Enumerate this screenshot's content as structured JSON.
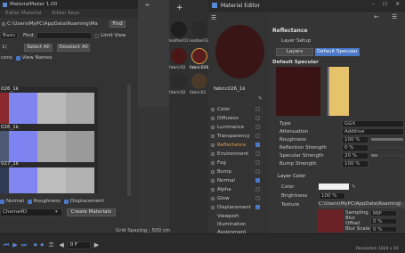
{
  "plugin": {
    "title": "MaterialMaker 1.00",
    "tabs": [
      "Editor Material",
      "Editor Keys"
    ],
    "path_value": "C:\\Users\\MyPC\\AppData\\Roaming\\Ma",
    "find_label": "Find",
    "preset_value": "Basic",
    "find_field_label": "Find:",
    "limit_view_label": "Limit View",
    "count_label": "1)",
    "select_all_label": "Select All",
    "deselect_all_label": "Deselect All",
    "icons_label": "cons",
    "view_names_label": "View Names",
    "rows": [
      {
        "label": "026_1k"
      },
      {
        "label": "026_1k"
      },
      {
        "label": "027_1k"
      }
    ],
    "bottom_checks": [
      "Normal",
      "Roughness",
      "Displacement"
    ],
    "renderer_value": "Chema4D",
    "create_materials_label": "Create Materials"
  },
  "timeline": {
    "grid_spacing": "Grid Spacing : 500 cm",
    "frame_value": "0 F"
  },
  "materials": {
    "items": [
      {
        "label": "leather01"
      },
      {
        "label": "leather03"
      },
      {
        "label": "fabric02"
      },
      {
        "label": "fabric026"
      },
      {
        "label": "fabric02"
      },
      {
        "label": "fabric01"
      }
    ]
  },
  "editor": {
    "title": "Material Editor",
    "preview_label": "fabric026_1k",
    "channels": [
      {
        "label": "Color",
        "on": false
      },
      {
        "label": "Diffusion",
        "on": false
      },
      {
        "label": "Luminance",
        "on": false
      },
      {
        "label": "Transparency",
        "on": false
      },
      {
        "label": "Reflectance",
        "on": true
      },
      {
        "label": "Environment",
        "on": false
      },
      {
        "label": "Fog",
        "on": false
      },
      {
        "label": "Bump",
        "on": false
      },
      {
        "label": "Normal",
        "on": true
      },
      {
        "label": "Alpha",
        "on": false
      },
      {
        "label": "Glow",
        "on": false
      },
      {
        "label": "Displacement",
        "on": true
      }
    ],
    "extra_items": [
      "Viewport",
      "Illumination",
      "Assignment"
    ],
    "section_title": "Reflectance",
    "layer_setup_label": "Layer Setup",
    "layer_tabs": [
      "Layers",
      "Default Specular"
    ],
    "layer_name": "Default Specular",
    "props": {
      "type_label": "Type",
      "type_value": "GGX",
      "attenuation_label": "Attenuation",
      "attenuation_value": "Additive",
      "roughness_label": "Roughness",
      "roughness_value": "100 %",
      "reflection_label": "Reflection Strength",
      "reflection_value": "0 %",
      "specular_label": "Specular Strength",
      "specular_value": "20 %",
      "bump_label": "Bump Strength",
      "bump_value": "100 %"
    },
    "layer_color": {
      "header": "Layer Color",
      "color_label": "Color",
      "brightness_label": "Brightness",
      "brightness_value": "100 %",
      "texture_label": "Texture",
      "texture_path": "C:\\Users\\MyPC\\AppData\\Roaming\\",
      "sampling_label": "Sampling",
      "sampling_value": "MIP",
      "blur_offset_label": "Blur Offset",
      "blur_offset_value": "0 %",
      "blur_scale_label": "Blur Scale",
      "blur_scale_value": "0 %",
      "resolution": "Resolution 1024 x 10"
    },
    "roughness_fraction": 1.0,
    "specular_fraction": 0.2
  },
  "colors": {
    "accent": "#4a78c9",
    "reflectance_text": "#e0a050"
  }
}
